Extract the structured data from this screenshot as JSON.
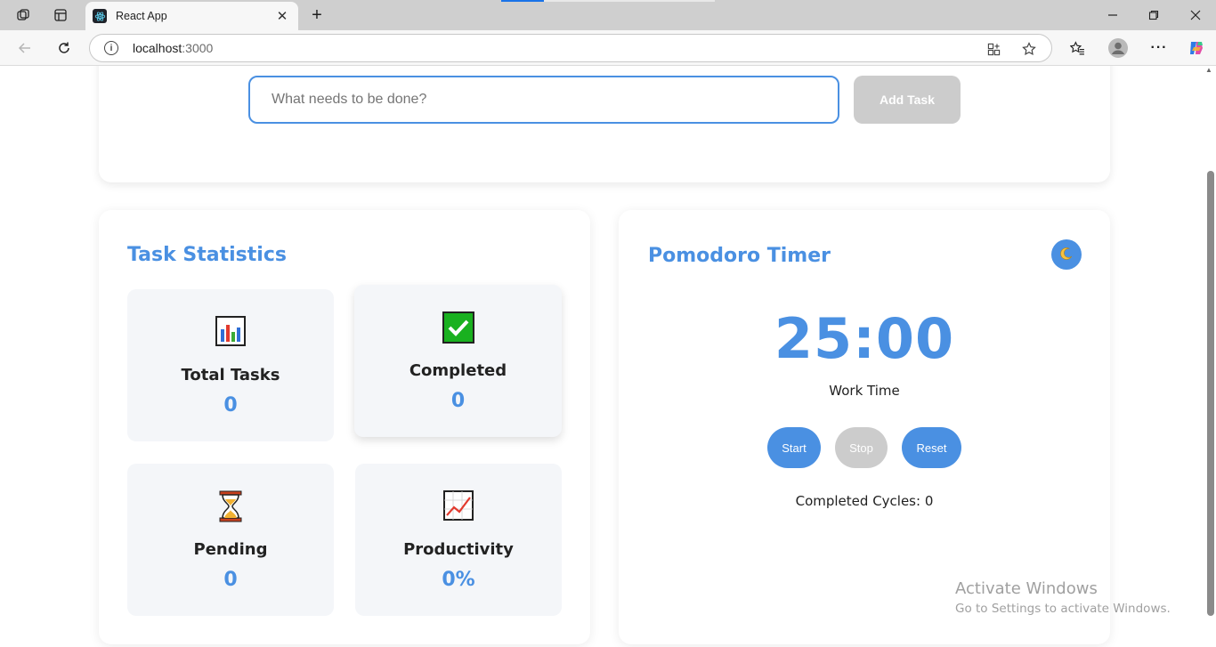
{
  "browser": {
    "tab_title": "React App",
    "url_host": "localhost",
    "url_port": ":3000"
  },
  "task_form": {
    "placeholder": "What needs to be done?",
    "input_value": "",
    "add_label": "Add Task"
  },
  "stats": {
    "title": "Task Statistics",
    "items": [
      {
        "label": "Total Tasks",
        "value": "0",
        "icon": "bar-chart-icon"
      },
      {
        "label": "Completed",
        "value": "0",
        "icon": "check-mark-icon"
      },
      {
        "label": "Pending",
        "value": "0",
        "icon": "hourglass-icon"
      },
      {
        "label": "Productivity",
        "value": "0%",
        "icon": "trending-up-icon"
      }
    ]
  },
  "timer": {
    "title": "Pomodoro Timer",
    "time": "25:00",
    "mode": "Work Time",
    "start_label": "Start",
    "stop_label": "Stop",
    "reset_label": "Reset",
    "cycles_text": "Completed Cycles: 0",
    "theme_icon": "moon-icon"
  },
  "watermark": {
    "line1": "Activate Windows",
    "line2": "Go to Settings to activate Windows."
  },
  "colors": {
    "accent": "#4a90e2",
    "disabled": "#cccccc",
    "stat_bg": "#f4f6f9"
  }
}
